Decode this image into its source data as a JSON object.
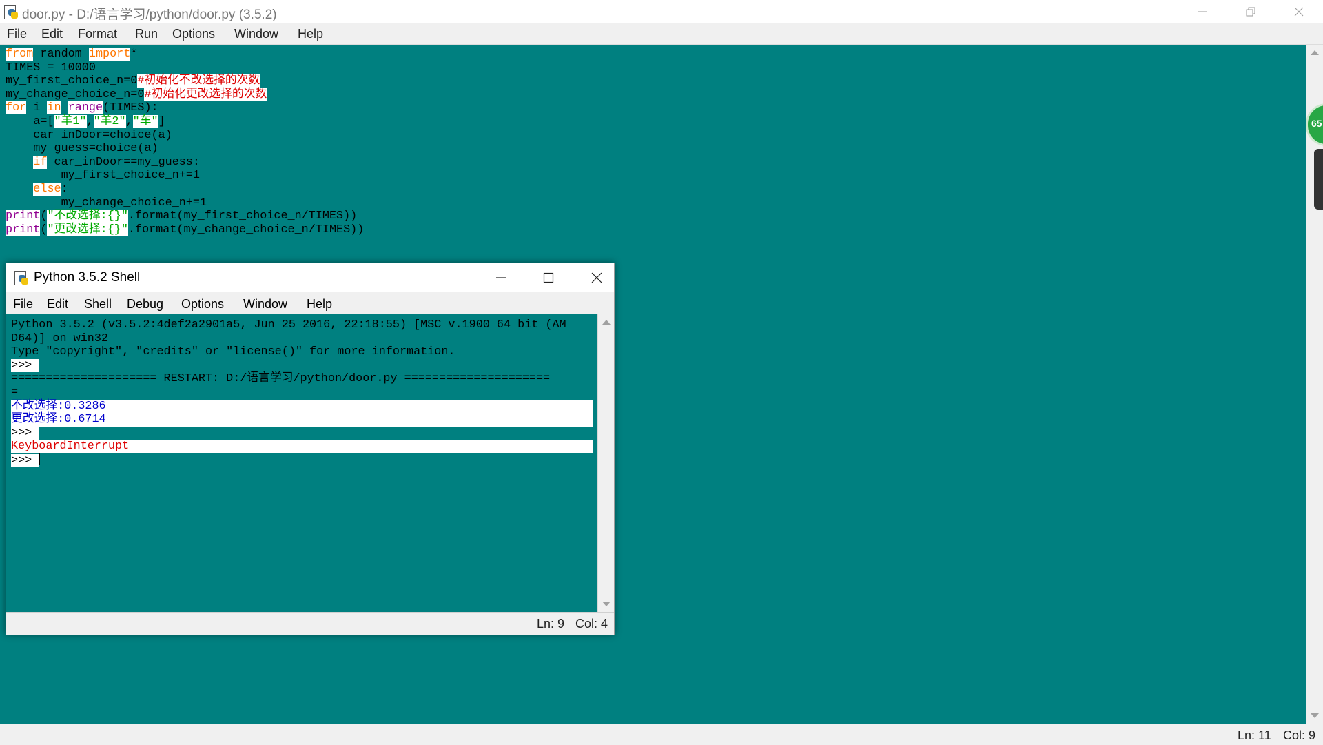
{
  "editor": {
    "title": "door.py - D:/语言学习/python/door.py (3.5.2)",
    "menu": [
      "File",
      "Edit",
      "Format",
      "Run",
      "Options",
      "Window",
      "Help"
    ],
    "code_lines": [
      [
        {
          "t": "from",
          "c": "kw"
        },
        {
          "t": " random "
        },
        {
          "t": "import",
          "c": "kw"
        },
        {
          "t": "*"
        }
      ],
      [
        {
          "t": "TIMES = 10000"
        }
      ],
      [
        {
          "t": "my_first_choice_n=0"
        },
        {
          "t": "#初始化不改选择的次数",
          "c": "cmt"
        }
      ],
      [
        {
          "t": "my_change_choice_n=0"
        },
        {
          "t": "#初始化更改选择的次数",
          "c": "cmt"
        }
      ],
      [
        {
          "t": "for",
          "c": "kw"
        },
        {
          "t": " i "
        },
        {
          "t": "in",
          "c": "kw"
        },
        {
          "t": " "
        },
        {
          "t": "range",
          "c": "bi"
        },
        {
          "t": "(TIMES):"
        }
      ],
      [
        {
          "t": "    a=["
        },
        {
          "t": "\"羊1\"",
          "c": "str"
        },
        {
          "t": ","
        },
        {
          "t": "\"羊2\"",
          "c": "str"
        },
        {
          "t": ","
        },
        {
          "t": "\"车\"",
          "c": "str"
        },
        {
          "t": "]"
        }
      ],
      [
        {
          "t": "    car_inDoor=choice(a)"
        }
      ],
      [
        {
          "t": "    my_guess=choice(a)"
        }
      ],
      [
        {
          "t": "    "
        },
        {
          "t": "if",
          "c": "kw"
        },
        {
          "t": " car_inDoor==my_guess:"
        }
      ],
      [
        {
          "t": "        my_first_choice_n+=1"
        }
      ],
      [
        {
          "t": "    "
        },
        {
          "t": "else",
          "c": "kw"
        },
        {
          "t": ":"
        }
      ],
      [
        {
          "t": "        my_change_choice_n+=1"
        }
      ],
      [
        {
          "t": "print",
          "c": "bi"
        },
        {
          "t": "("
        },
        {
          "t": "\"不改选择:{}\"",
          "c": "str"
        },
        {
          "t": ".format(my_first_choice_n/TIMES))"
        }
      ],
      [
        {
          "t": "print",
          "c": "bi"
        },
        {
          "t": "("
        },
        {
          "t": "\"更改选择:{}\"",
          "c": "str"
        },
        {
          "t": ".format(my_change_choice_n/TIMES))"
        }
      ]
    ],
    "status": {
      "ln": "Ln: 11",
      "col": "Col: 9"
    },
    "side_badge": "65"
  },
  "shell": {
    "title": "Python 3.5.2 Shell",
    "menu": [
      "File",
      "Edit",
      "Shell",
      "Debug",
      "Options",
      "Window",
      "Help"
    ],
    "lines": [
      {
        "t": "Python 3.5.2 (v3.5.2:4def2a2901a5, Jun 25 2016, 22:18:55) [MSC v.1900 64 bit (AM"
      },
      {
        "t": "D64)] on win32"
      },
      {
        "t": "Type \"copyright\", \"credits\" or \"license()\" for more information."
      },
      {
        "t": ">>> ",
        "k": "prompt"
      },
      {
        "t": "===================== RESTART: D:/语言学习/python/door.py ====================="
      },
      {
        "t": "="
      },
      {
        "t": "不改选择:0.3286",
        "k": "out-blue",
        "band": true
      },
      {
        "t": "更改选择:0.6714",
        "k": "out-blue",
        "band": true
      },
      {
        "t": ">>> ",
        "k": "prompt"
      },
      {
        "t": "KeyboardInterrupt",
        "k": "out-red",
        "band": true
      },
      {
        "t": ">>> ",
        "k": "prompt",
        "cursor": true
      }
    ],
    "status": {
      "ln": "Ln: 9",
      "col": "Col: 4"
    }
  }
}
